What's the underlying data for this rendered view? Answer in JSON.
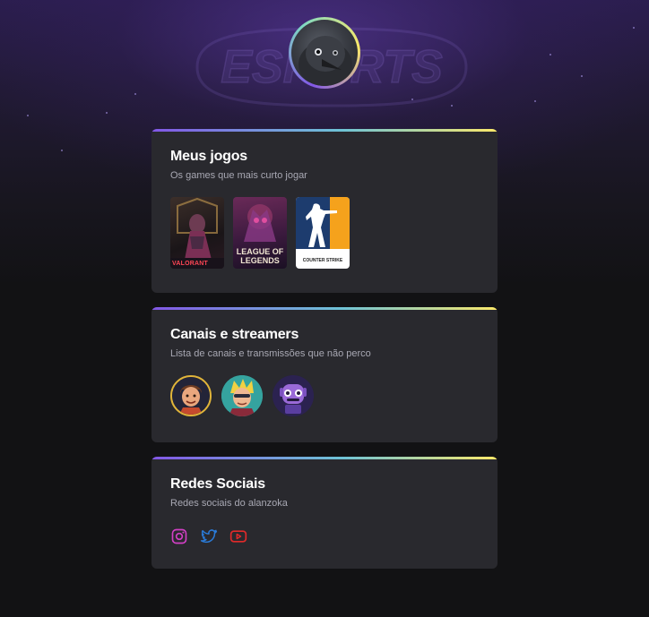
{
  "header": {
    "background_word": "ESPORTS",
    "avatar_icon": "crow-avatar"
  },
  "games_card": {
    "title": "Meus jogos",
    "subtitle": "Os games que mais curto jogar",
    "games": [
      {
        "name": "VALORANT",
        "icon": "valorant-cover"
      },
      {
        "name": "LEAGUE OF LEGENDS",
        "icon": "league-of-legends-cover"
      },
      {
        "name": "COUNTER STRIKE",
        "icon": "counter-strike-cover"
      }
    ]
  },
  "streamers_card": {
    "title": "Canais e streamers",
    "subtitle": "Lista de canais e transmissões que não perco",
    "streamers": [
      {
        "icon": "streamer-avatar-1"
      },
      {
        "icon": "streamer-avatar-2"
      },
      {
        "icon": "streamer-avatar-3"
      }
    ]
  },
  "social_card": {
    "title": "Redes Sociais",
    "subtitle": "Redes sociais do alanzoka",
    "links": [
      {
        "icon": "instagram-icon",
        "color": "#d13fc4"
      },
      {
        "icon": "twitter-icon",
        "color": "#2a7bd8"
      },
      {
        "icon": "youtube-icon",
        "color": "#e12a2a"
      }
    ]
  },
  "colors": {
    "background": "#121214",
    "card": "#29292e",
    "title": "#ffffff",
    "subtitle": "#a8a8b3",
    "gradient": [
      "#8257e6",
      "#6ec3d6",
      "#fbe96a"
    ]
  }
}
